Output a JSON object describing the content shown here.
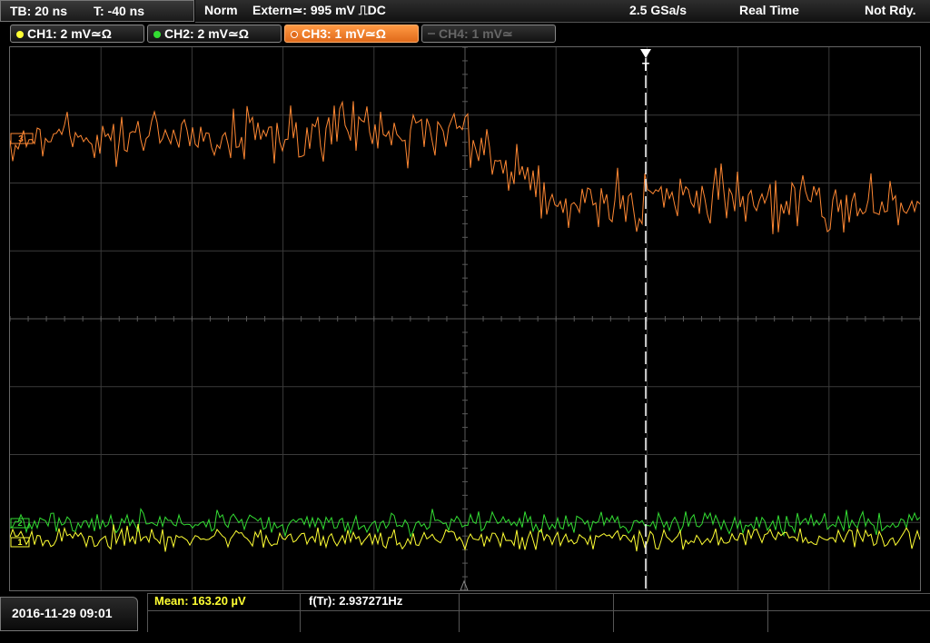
{
  "header": {
    "timebase": "TB: 20 ns",
    "trigger_time": "T: -40 ns",
    "trigger_mode": "Norm",
    "trigger_source": "Extern≃: 995 mV ⎍DC",
    "sample_rate": "2.5 GSa/s",
    "acq_mode": "Real Time",
    "status": "Not Rdy."
  },
  "channels": [
    {
      "label": "CH1: 2 mV≃Ω",
      "color": "#ffff33"
    },
    {
      "label": "CH2: 2 mV≃Ω",
      "color": "#33dd33"
    },
    {
      "label": "CH3: 1 mV≃Ω",
      "color": "#ff8833"
    },
    {
      "label": "CH4: 1 mV≃",
      "color": "#555555"
    }
  ],
  "markers": {
    "ch3_marker": "3",
    "ch2_marker": "2",
    "ch1_marker": "1",
    "trigger_marker": "T"
  },
  "footer": {
    "datetime": "2016-11-29 09:01",
    "mean": "Mean: 163.20 µV",
    "freq": "f(Tr): 2.937271Hz"
  }
}
